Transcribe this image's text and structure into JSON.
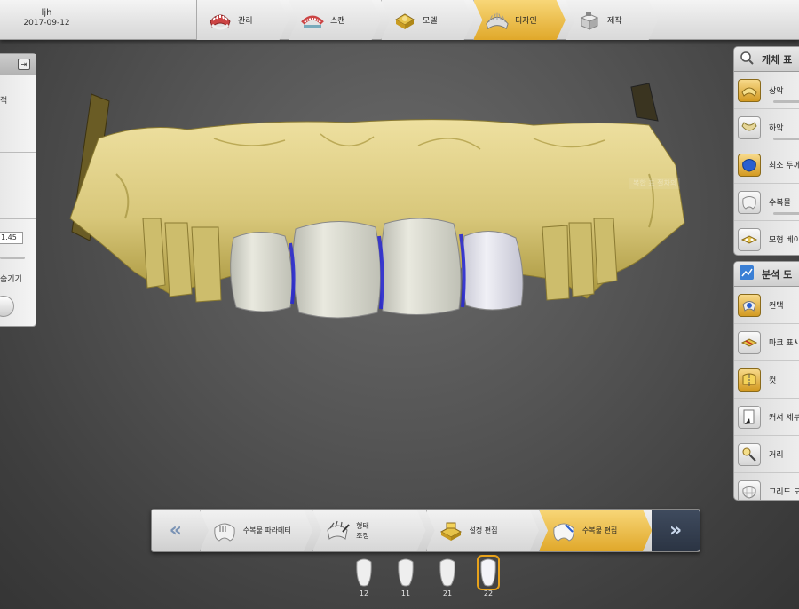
{
  "user": {
    "name": "ljh",
    "date": "2017-09-12"
  },
  "workflow_steps": [
    {
      "label": "관리",
      "icon": "denture-icon",
      "active": false
    },
    {
      "label": "스캔",
      "icon": "scan-arch-icon",
      "active": false
    },
    {
      "label": "모델",
      "icon": "model-base-icon",
      "active": false
    },
    {
      "label": "디자인",
      "icon": "design-crowns-icon",
      "active": true
    },
    {
      "label": "제작",
      "icon": "milling-block-icon",
      "active": false
    }
  ],
  "left_panel": {
    "pin_symbol": "⇥",
    "text1": "적",
    "value": "1.45",
    "text2": "숨기기"
  },
  "object_panel": {
    "title": "개체 표",
    "items": [
      {
        "label": "상악",
        "icon": "upper-jaw-icon",
        "gold": true,
        "bar": true
      },
      {
        "label": "하악",
        "icon": "lower-jaw-icon",
        "gold": false,
        "bar": true
      },
      {
        "label": "최소 두께",
        "icon": "min-thickness-icon",
        "gold": true,
        "bar": false
      },
      {
        "label": "수복물",
        "icon": "restoration-icon",
        "gold": false,
        "bar": true
      },
      {
        "label": "모형 베이",
        "icon": "model-base-icon",
        "gold": false,
        "bar": false
      }
    ]
  },
  "analysis_panel": {
    "title": "분석 도",
    "items": [
      {
        "label": "컨택",
        "icon": "contact-icon",
        "gold": true
      },
      {
        "label": "마크 표시",
        "icon": "mark-icon",
        "gold": false
      },
      {
        "label": "컷",
        "icon": "cut-icon",
        "gold": true
      },
      {
        "label": "커서 세부",
        "icon": "cursor-detail-icon",
        "gold": false
      },
      {
        "label": "거리",
        "icon": "distance-icon",
        "gold": false
      },
      {
        "label": "그리드 모",
        "icon": "grid-icon",
        "gold": false
      }
    ]
  },
  "viewport": {
    "ghost_tag": "복합 표 절차의"
  },
  "bottom_bar": {
    "prev_symbol": "«",
    "next_symbol": "»",
    "tabs": [
      {
        "label": "수복물 파라메터",
        "icon": "restoration-params-icon",
        "active": false
      },
      {
        "label": "형태\n조정",
        "icon": "shape-adjust-icon",
        "active": false
      },
      {
        "label": "설정 편집",
        "icon": "settings-edit-icon",
        "active": false
      },
      {
        "label": "수복물 편집",
        "icon": "restoration-edit-icon",
        "active": true
      }
    ]
  },
  "teeth_selector": [
    {
      "number": "12",
      "selected": false
    },
    {
      "number": "11",
      "selected": false
    },
    {
      "number": "21",
      "selected": false
    },
    {
      "number": "22",
      "selected": true
    }
  ],
  "colors": {
    "accent_gold": "#e0a82a",
    "model_yellow": "#d8c77a",
    "crown_ivory": "#dcdccf",
    "contact_blue": "#2a2ad0"
  }
}
